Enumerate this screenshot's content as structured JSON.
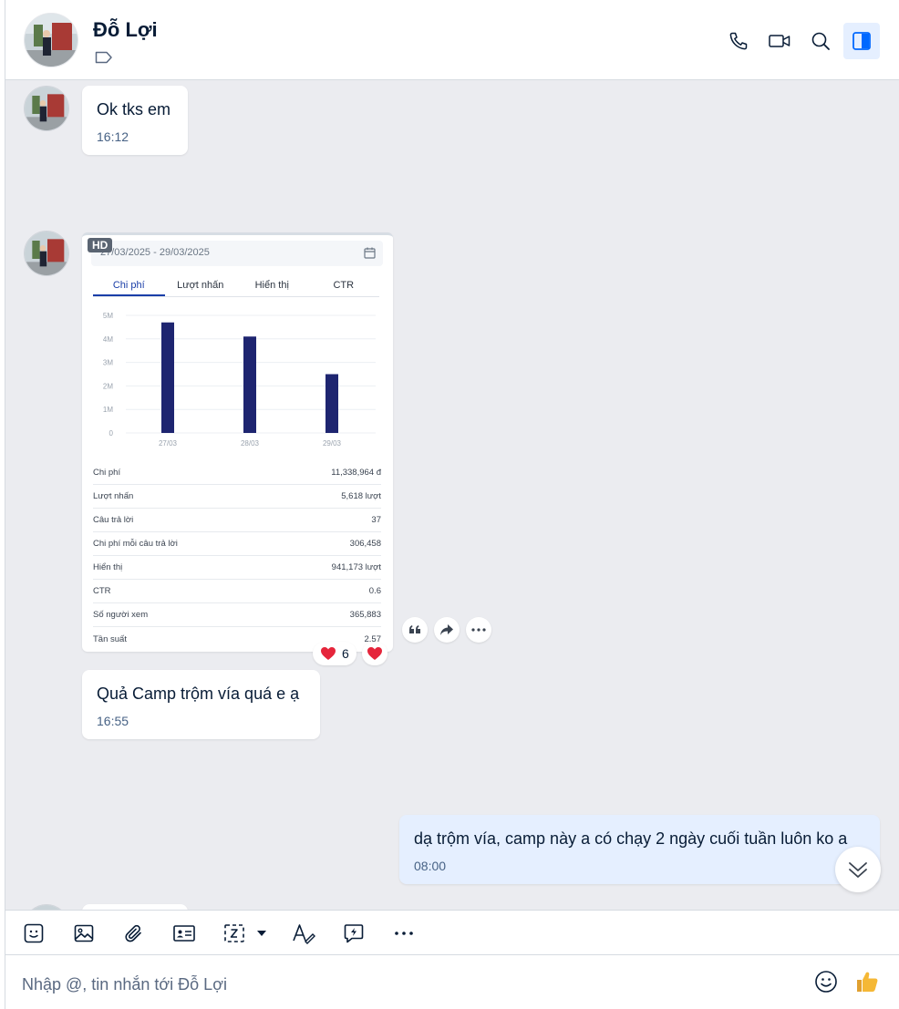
{
  "header": {
    "contact_name": "Đỗ Lợi"
  },
  "messages": [
    {
      "text": "Ok tks em",
      "time": "16:12"
    },
    {
      "text": "Quả Camp trộm vía quá e ạ",
      "time": "16:55"
    },
    {
      "text": "dạ trộm vía, camp này a có chạy 2 ngày cuối tuần luôn ko a",
      "time": "08:00"
    }
  ],
  "image_card": {
    "badge": "HD",
    "date_range": "27/03/2025 - 29/03/2025",
    "tabs": [
      "Chi phí",
      "Lượt nhấn",
      "Hiển thị",
      "CTR"
    ],
    "metrics": [
      {
        "label": "Chi phí",
        "value": "11,338,964 đ"
      },
      {
        "label": "Lượt nhấn",
        "value": "5,618 lượt"
      },
      {
        "label": "Câu trả lời",
        "value": "37"
      },
      {
        "label": "Chi phí mỗi câu trả lời",
        "value": "306,458"
      },
      {
        "label": "Hiển thị",
        "value": "941,173 lượt"
      },
      {
        "label": "CTR",
        "value": "0.6"
      },
      {
        "label": "Số người xem",
        "value": "365,883"
      },
      {
        "label": "Tần suất",
        "value": "2.57"
      }
    ]
  },
  "reactions": {
    "count": "6",
    "emoji": "heart"
  },
  "composer": {
    "placeholder": "Nhập @, tin nhắn tới Đỗ Lợi"
  },
  "colors": {
    "accent": "#0068ff",
    "bar": "#1e2570",
    "chat_bg": "#ebecf0",
    "my_bubble": "#e5efff"
  },
  "chart_data": {
    "type": "bar",
    "categories": [
      "27/03",
      "28/03",
      "29/03"
    ],
    "values": [
      4.7,
      4.1,
      2.5
    ],
    "ylim": [
      0,
      5
    ],
    "yticks": [
      "0",
      "1M",
      "2M",
      "3M",
      "4M",
      "5M"
    ],
    "grid": true
  }
}
